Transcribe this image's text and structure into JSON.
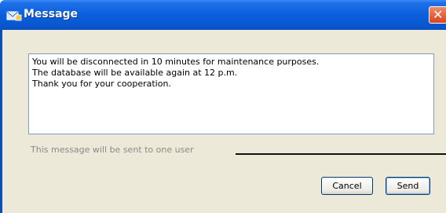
{
  "window": {
    "title": "Message",
    "icon": "message-app-icon",
    "close_glyph": "✕"
  },
  "message": {
    "lines": [
      "You will be disconnected in 10 minutes for maintenance purposes.",
      "The database will be available again at 12 p.m.",
      "Thank you for your cooperation."
    ]
  },
  "status": {
    "text": "This message will be sent to one user"
  },
  "buttons": {
    "cancel_label": "Cancel",
    "send_label": "Send"
  },
  "colors": {
    "titlebar": "#0a5fdd",
    "client_bg": "#ece9d8",
    "close_button": "#d9441c",
    "status_text": "#8a8a8a"
  }
}
